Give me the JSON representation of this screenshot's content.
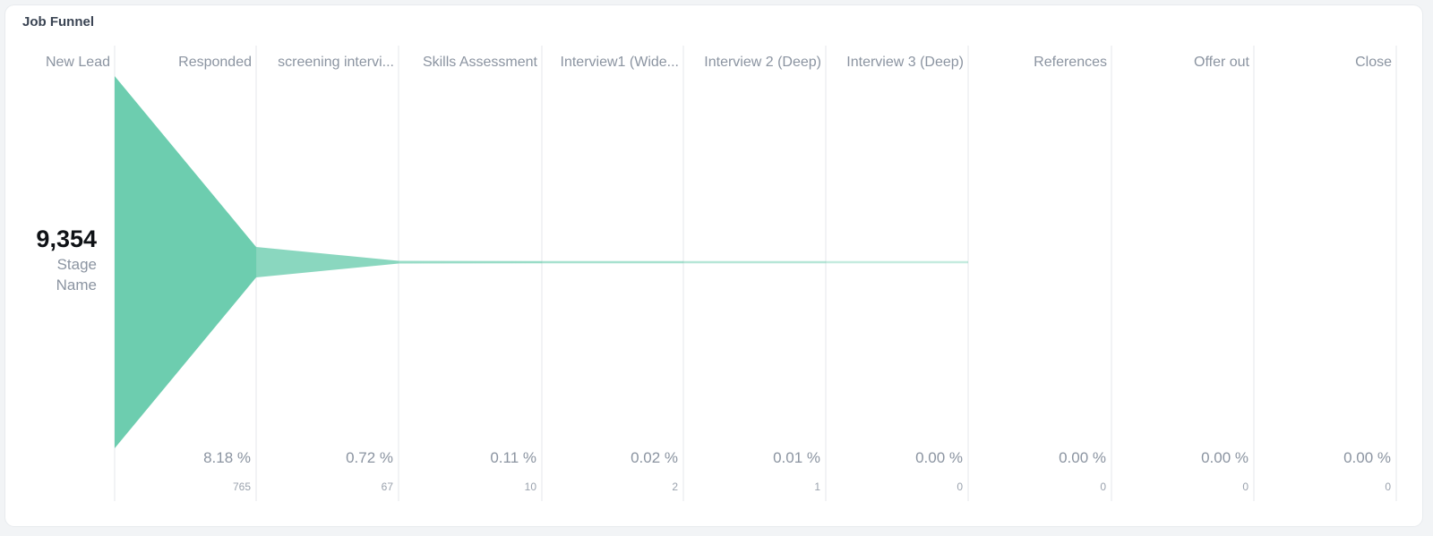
{
  "card": {
    "title": "Job Funnel"
  },
  "summary": {
    "total": "9,354",
    "caption": "Stage Name"
  },
  "colors": {
    "funnel": "#6dcdaf",
    "divider": "#e4e7eb"
  },
  "chart_data": {
    "type": "funnel",
    "title": "Job Funnel",
    "stages": [
      {
        "name": "New Lead",
        "count": 9354,
        "count_label": "",
        "pct_label": ""
      },
      {
        "name": "Responded",
        "count": 765,
        "count_label": "765",
        "pct_label": "8.18 %"
      },
      {
        "name": "screening intervi...",
        "count": 67,
        "count_label": "67",
        "pct_label": "0.72 %"
      },
      {
        "name": "Skills Assessment",
        "count": 10,
        "count_label": "10",
        "pct_label": "0.11 %"
      },
      {
        "name": "Interview1 (Wide...",
        "count": 2,
        "count_label": "2",
        "pct_label": "0.02 %"
      },
      {
        "name": "Interview 2 (Deep)",
        "count": 1,
        "count_label": "1",
        "pct_label": "0.01 %"
      },
      {
        "name": "Interview 3 (Deep)",
        "count": 0,
        "count_label": "0",
        "pct_label": "0.00 %"
      },
      {
        "name": "References",
        "count": 0,
        "count_label": "0",
        "pct_label": "0.00 %"
      },
      {
        "name": "Offer out",
        "count": 0,
        "count_label": "0",
        "pct_label": "0.00 %"
      },
      {
        "name": "Close",
        "count": 0,
        "count_label": "0",
        "pct_label": "0.00 %"
      }
    ]
  }
}
